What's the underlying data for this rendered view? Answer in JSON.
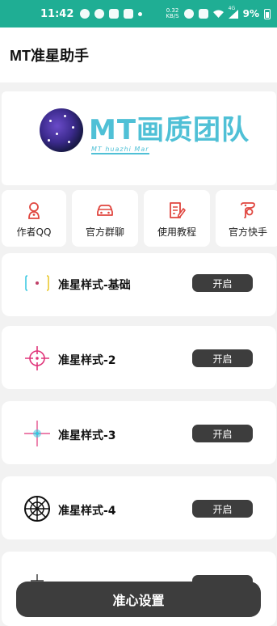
{
  "status_bar": {
    "time": "11:42",
    "net_speed_value": "0.32",
    "net_speed_unit": "KB/S",
    "signal_label": "4G",
    "battery": "9%"
  },
  "app_bar": {
    "title": "MT准星助手"
  },
  "banner": {
    "logo_text": "MT画质团队",
    "logo_subtext": "MT huazhi Mar"
  },
  "shortcuts": [
    {
      "label": "作者QQ",
      "icon": "person-icon",
      "color": "#e0463f"
    },
    {
      "label": "官方群聊",
      "icon": "car-icon",
      "color": "#e0463f"
    },
    {
      "label": "使用教程",
      "icon": "document-edit-icon",
      "color": "#e0463f"
    },
    {
      "label": "官方快手",
      "icon": "kuaishou-icon",
      "color": "#e0463f"
    }
  ],
  "crosshairs": [
    {
      "label": "准星样式-基础",
      "button": "开启",
      "icon": "crosshair-basic-icon"
    },
    {
      "label": "准星样式-2",
      "button": "开启",
      "icon": "crosshair-pink-icon"
    },
    {
      "label": "准星样式-3",
      "button": "开启",
      "icon": "crosshair-cyan-icon"
    },
    {
      "label": "准星样式-4",
      "button": "开启",
      "icon": "crosshair-scope-icon"
    }
  ],
  "bottom_button": {
    "label": "准心设置"
  },
  "colors": {
    "status_bar": "#1fae94",
    "button_dark": "#3d3d3d",
    "accent_red": "#e0463f",
    "logo_cyan": "#4fc0d6",
    "crosshair_pink": "#e0357a",
    "crosshair_cyan": "#33c6e0"
  }
}
